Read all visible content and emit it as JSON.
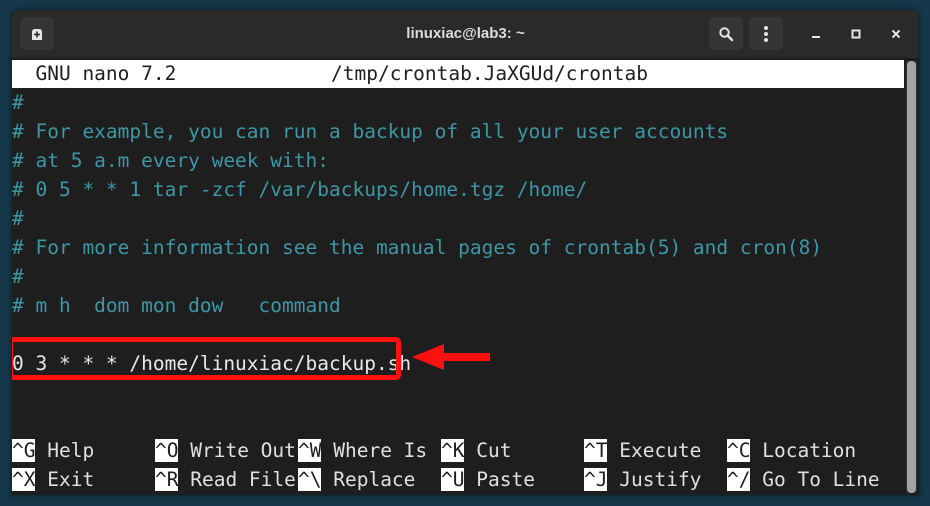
{
  "window": {
    "title": "linuxiac@lab3: ~",
    "buttons": {
      "new_tab": "new-tab-icon",
      "search": "search-icon",
      "menu": "kebab-menu-icon",
      "minimize": "minimize-icon",
      "maximize": "maximize-icon",
      "close": "close-icon"
    }
  },
  "nano": {
    "version_label": "  GNU nano 7.2",
    "filename": "/tmp/crontab.JaXGUd/crontab",
    "lines": [
      {
        "text": "#",
        "type": "comment"
      },
      {
        "text": "# For example, you can run a backup of all your user accounts",
        "type": "comment"
      },
      {
        "text": "# at 5 a.m every week with:",
        "type": "comment"
      },
      {
        "text": "# 0 5 * * 1 tar -zcf /var/backups/home.tgz /home/",
        "type": "comment"
      },
      {
        "text": "#",
        "type": "comment"
      },
      {
        "text": "# For more information see the manual pages of crontab(5) and cron(8)",
        "type": "comment"
      },
      {
        "text": "#",
        "type": "comment"
      },
      {
        "text": "# m h  dom mon dow   command",
        "type": "comment"
      },
      {
        "text": "",
        "type": "plain"
      },
      {
        "text": "0 3 * * * /home/linuxiac/backup.sh",
        "type": "plain"
      }
    ],
    "highlight": {
      "color": "#ff1010",
      "annotation": "arrow-left"
    },
    "shortcuts": {
      "row1": [
        {
          "key": "^G",
          "label": "Help"
        },
        {
          "key": "^O",
          "label": "Write Out"
        },
        {
          "key": "^W",
          "label": "Where Is"
        },
        {
          "key": "^K",
          "label": "Cut"
        },
        {
          "key": "^T",
          "label": "Execute"
        },
        {
          "key": "^C",
          "label": "Location"
        }
      ],
      "row2": [
        {
          "key": "^X",
          "label": "Exit"
        },
        {
          "key": "^R",
          "label": "Read File"
        },
        {
          "key": "^\\",
          "label": "Replace"
        },
        {
          "key": "^U",
          "label": "Paste"
        },
        {
          "key": "^J",
          "label": "Justify"
        },
        {
          "key": "^/",
          "label": "Go To Line"
        }
      ]
    }
  },
  "colors": {
    "comment": "#3d97a6",
    "desktop": "#15384a",
    "terminal_bg": "#1e1e1e"
  }
}
